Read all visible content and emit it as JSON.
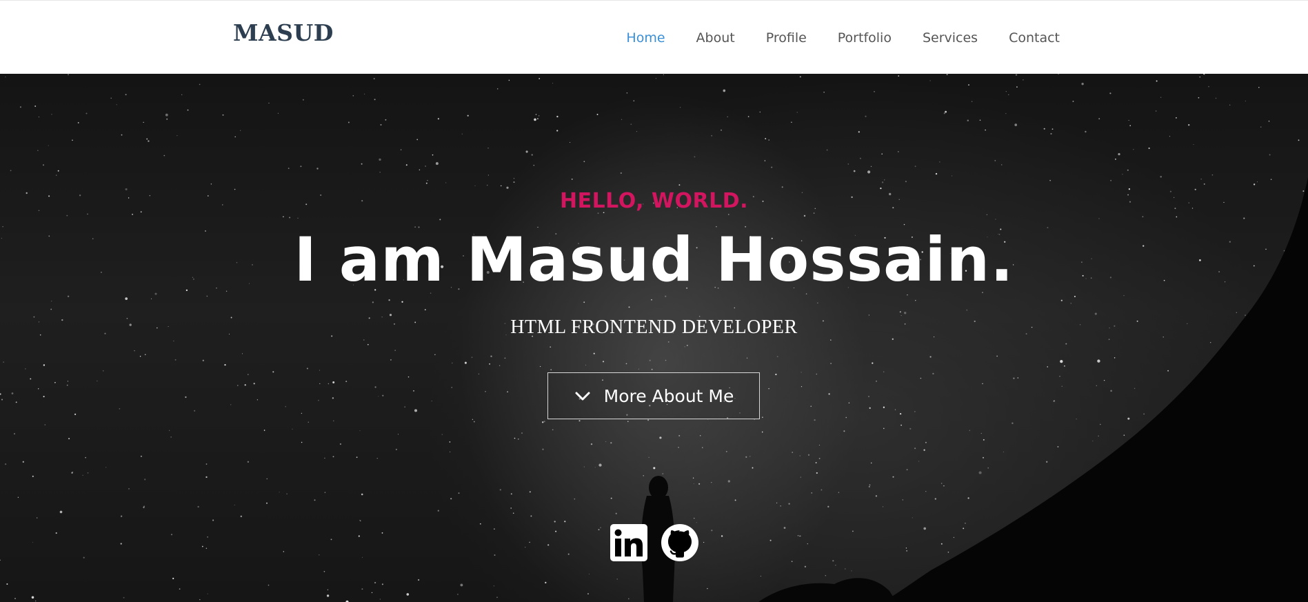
{
  "nav": {
    "logo": "MASUD",
    "items": [
      {
        "label": "Home",
        "active": true
      },
      {
        "label": "About",
        "active": false
      },
      {
        "label": "Profile",
        "active": false
      },
      {
        "label": "Portfolio",
        "active": false
      },
      {
        "label": "Services",
        "active": false
      },
      {
        "label": "Contact",
        "active": false
      }
    ]
  },
  "hero": {
    "greeting": "HELLO, WORLD.",
    "headline": "I am Masud Hossain.",
    "subtitle": "HTML FRONTEND DEVELOPER",
    "cta": {
      "label": "More About Me",
      "icon": "chevron-down-icon"
    },
    "social": [
      {
        "name": "linkedin-icon"
      },
      {
        "name": "github-icon"
      }
    ]
  },
  "colors": {
    "accent": "#d1155f",
    "nav_active": "#3a8fd6",
    "logo": "#2c3e50",
    "nav_text": "#555555"
  }
}
